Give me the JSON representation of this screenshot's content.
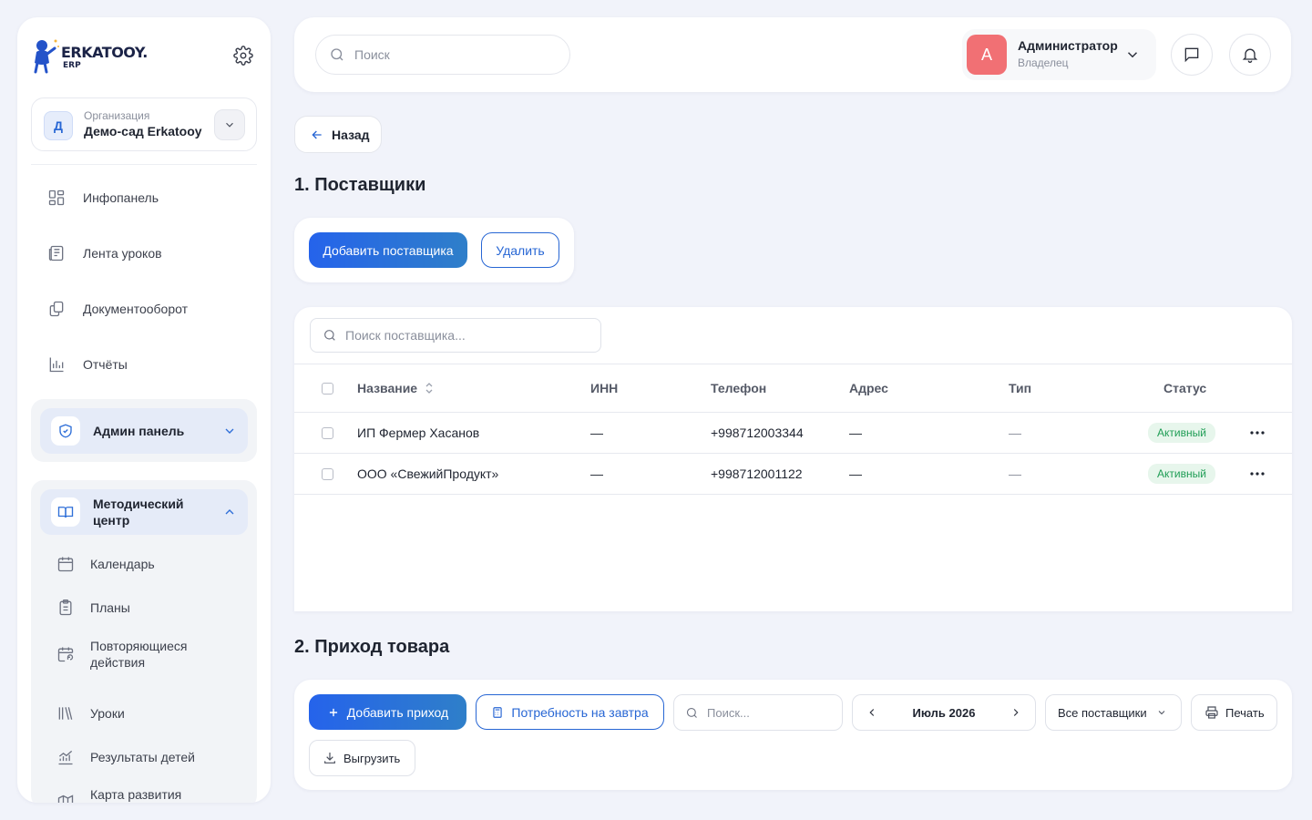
{
  "brand": {
    "name": "ERKATOOY.",
    "sub": "ERP"
  },
  "organization": {
    "label": "Организация",
    "name": "Демо-сад Erkatooy",
    "initial": "Д"
  },
  "nav": {
    "items": [
      {
        "label": "Инфопанель"
      },
      {
        "label": "Лента уроков"
      },
      {
        "label": "Документооборот"
      },
      {
        "label": "Отчёты"
      }
    ],
    "admin_group": {
      "label": "Админ панель"
    },
    "method_group": {
      "label": "Методический центр",
      "items": [
        {
          "label": "Календарь"
        },
        {
          "label": "Планы"
        },
        {
          "label": "Повторяющиеся действия"
        },
        {
          "label": "Уроки"
        },
        {
          "label": "Результаты детей"
        },
        {
          "label": "Карта развития ребенка"
        }
      ]
    }
  },
  "header": {
    "search_placeholder": "Поиск",
    "user": {
      "initial": "А",
      "name": "Администратор",
      "role": "Владелец"
    }
  },
  "back_label": "Назад",
  "suppliers": {
    "title": "1. Поставщики",
    "add_label": "Добавить поставщика",
    "delete_label": "Удалить",
    "search_placeholder": "Поиск поставщика...",
    "columns": {
      "name": "Название",
      "inn": "ИНН",
      "phone": "Телефон",
      "address": "Адрес",
      "type": "Тип",
      "status": "Статус"
    },
    "rows": [
      {
        "name": "ИП Фермер Хасанов",
        "inn": "—",
        "phone": "+998712003344",
        "address": "—",
        "type": "—",
        "status": "Активный"
      },
      {
        "name": "ООО «СвежийПродукт»",
        "inn": "—",
        "phone": "+998712001122",
        "address": "—",
        "type": "—",
        "status": "Активный"
      }
    ]
  },
  "income": {
    "title": "2. Приход товара",
    "add_label": "Добавить приход",
    "need_label": "Потребность на завтра",
    "search_placeholder": "Поиск...",
    "month": "Июль 2026",
    "supplier_filter": "Все поставщики",
    "print_label": "Печать",
    "export_label": "Выгрузить"
  },
  "colors": {
    "accent": "#2766d4",
    "active_badge_bg": "#e7f6ec",
    "active_badge_text": "#1f9d55",
    "avatar": "#f17074"
  }
}
